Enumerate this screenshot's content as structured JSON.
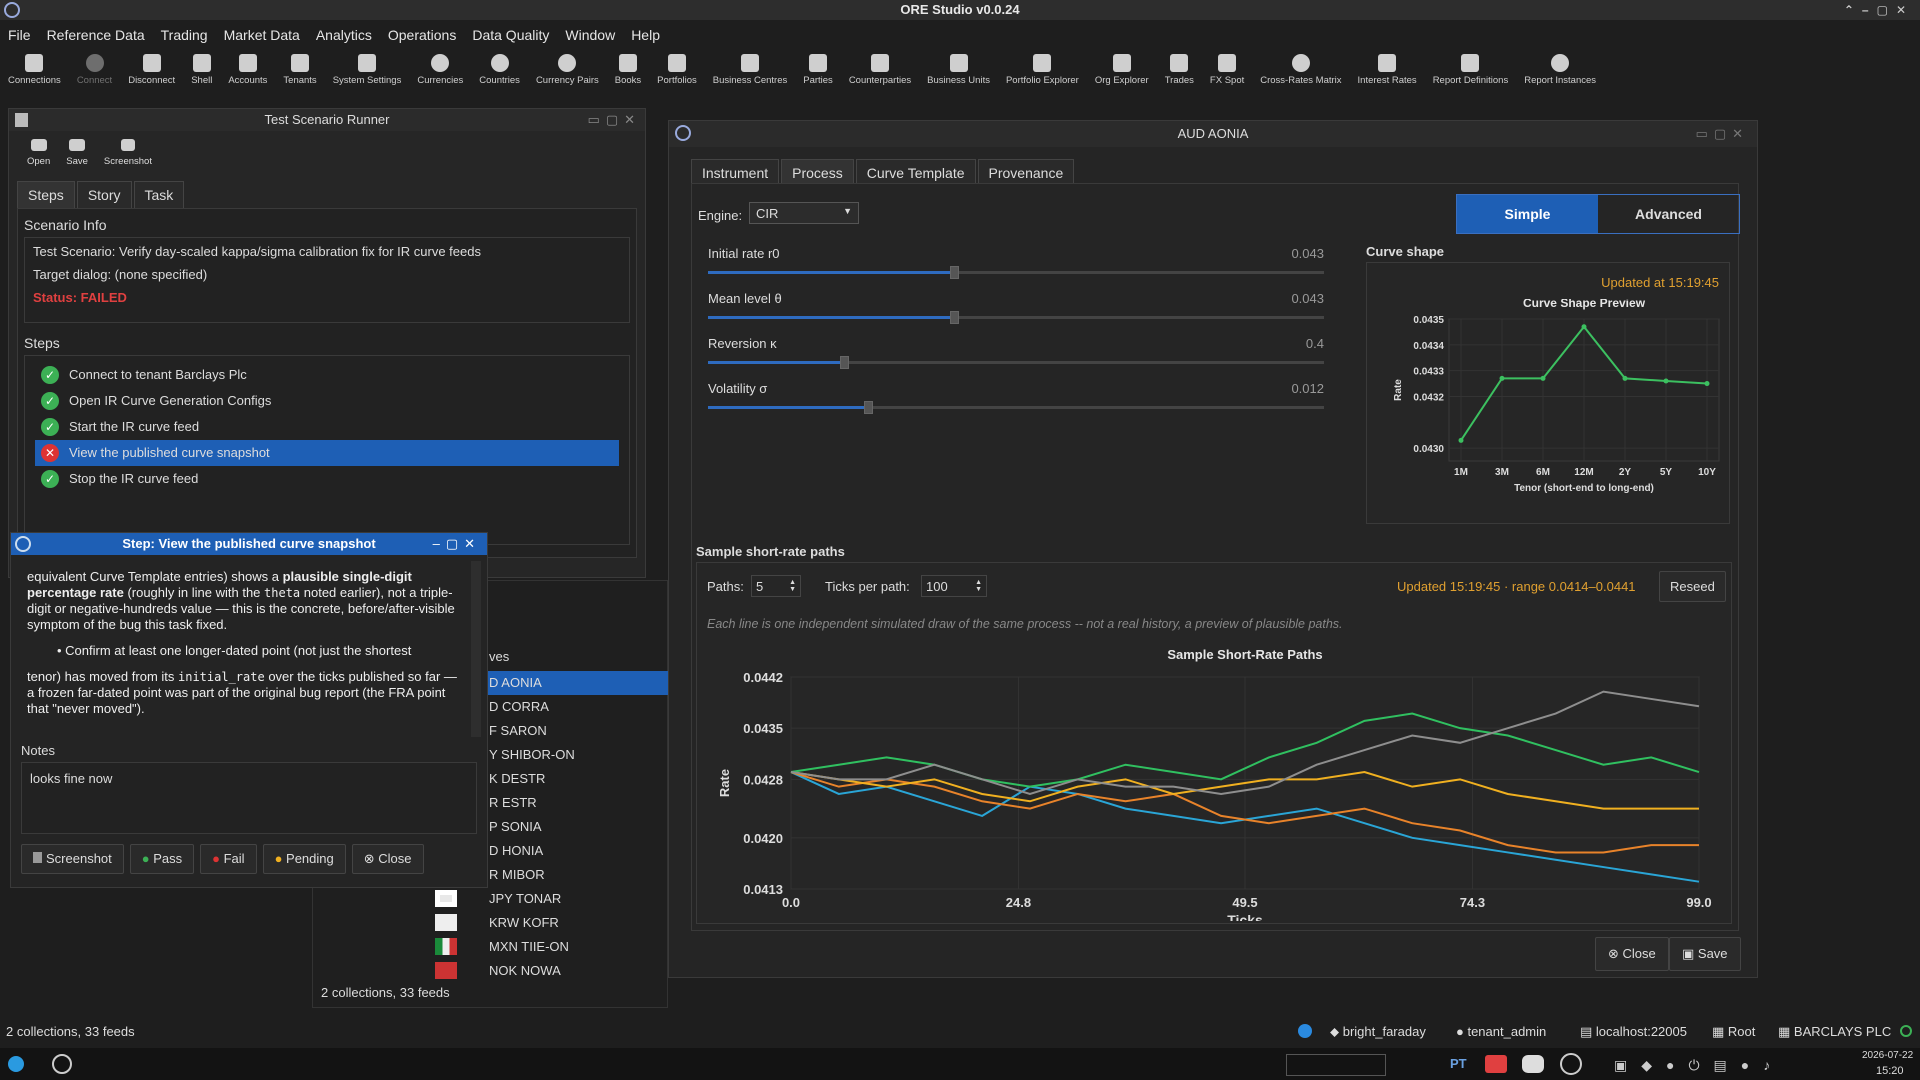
{
  "app_title": "ORE Studio v0.0.24",
  "menu": [
    "File",
    "Reference Data",
    "Trading",
    "Market Data",
    "Analytics",
    "Operations",
    "Data Quality",
    "Window",
    "Help"
  ],
  "toolbar": [
    "Connections",
    "Connect",
    "Disconnect",
    "Shell",
    "Accounts",
    "Tenants",
    "System Settings",
    "Currencies",
    "Countries",
    "Currency Pairs",
    "Books",
    "Portfolios",
    "Business Centres",
    "Parties",
    "Counterparties",
    "Business Units",
    "Portfolio Explorer",
    "Org Explorer",
    "Trades",
    "FX Spot",
    "Cross-Rates Matrix",
    "Interest Rates",
    "Report Definitions",
    "Report Instances"
  ],
  "runner": {
    "title": "Test Scenario Runner",
    "tools": [
      "Open",
      "Save",
      "Screenshot"
    ],
    "tabs": [
      "Steps",
      "Story",
      "Task"
    ],
    "info_heading": "Scenario Info",
    "scenario": "Test Scenario: Verify day-scaled kappa/sigma calibration fix for IR curve feeds",
    "target": "Target dialog: (none specified)",
    "status": "Status: FAILED",
    "steps_heading": "Steps",
    "steps": [
      "Connect to tenant Barclays Plc",
      "Open IR Curve Generation Configs",
      "Start the IR curve feed",
      "View the published curve snapshot",
      "Stop the IR curve feed"
    ]
  },
  "stepdlg": {
    "title": "Step: View the published curve snapshot",
    "para1a": "equivalent Curve Template entries) shows a ",
    "para1b": "plausible single-digit percentage rate",
    "para1c": " (roughly in line with the ",
    "para1code": "theta",
    "para1d": " noted earlier), not a triple-digit or negative-hundreds value — this is the concrete, before/after-visible symptom of the bug this task fixed.",
    "bullet": "• Confirm at least one longer-dated point (not just the shortest",
    "para2a": "tenor) has moved from its ",
    "para2code": "initial_rate",
    "para2b": " over the ticks published so far — a frozen far-dated point was part of the original bug report (the FRA point that \"never moved\").",
    "notes_label": "Notes",
    "notes": "looks fine now",
    "buttons": [
      "Screenshot",
      "Pass",
      "Fail",
      "Pending",
      "Close"
    ]
  },
  "feeds": {
    "header": "ves",
    "items": [
      "D AONIA",
      "D CORRA",
      "F SARON",
      "Y SHIBOR-ON",
      "K DESTR",
      "R ESTR",
      "P SONIA",
      "D HONIA",
      "R MIBOR",
      "JPY TONAR",
      "KRW KOFR",
      "MXN TIIE-ON",
      "NOK NOWA"
    ],
    "footer": "2 collections, 33 feeds"
  },
  "aonia": {
    "title": "AUD AONIA",
    "tabs": [
      "Instrument",
      "Process",
      "Curve Template",
      "Provenance"
    ],
    "engine_label": "Engine:",
    "engine": "CIR",
    "modes": [
      "Simple",
      "Advanced"
    ],
    "sliders": [
      {
        "label": "Initial rate r0",
        "value": "0.043",
        "pos": 0.4
      },
      {
        "label": "Mean level θ",
        "value": "0.043",
        "pos": 0.4
      },
      {
        "label": "Reversion κ",
        "value": "0.4",
        "pos": 0.22
      },
      {
        "label": "Volatility σ",
        "value": "0.012",
        "pos": 0.26
      }
    ],
    "curve_heading": "Curve shape",
    "curve_updated": "Updated at 15:19:45",
    "paths_heading": "Sample short-rate paths",
    "paths_label": "Paths:",
    "paths": "5",
    "ticks_label": "Ticks per path:",
    "ticks": "100",
    "paths_updated": "Updated 15:19:45 · range 0.0414–0.0441",
    "reseed": "Reseed",
    "caption": "Each line is one independent simulated draw of the same process -- not a real history, a preview of plausible paths.",
    "close": "Close",
    "save": "Save"
  },
  "status": {
    "left": "2 collections, 33 feeds",
    "items": [
      "bright_faraday",
      "tenant_admin",
      "localhost:22005",
      "Root",
      "BARCLAYS PLC"
    ]
  },
  "taskbar": {
    "lang": "PT",
    "date": "2026-07-22",
    "time": "15:20"
  },
  "chart_data": [
    {
      "type": "line",
      "title": "Curve Shape Preview",
      "xlabel": "Tenor (short-end to long-end)",
      "ylabel": "Rate",
      "categories": [
        "1M",
        "3M",
        "6M",
        "12M",
        "2Y",
        "5Y",
        "10Y"
      ],
      "values": [
        0.04303,
        0.04327,
        0.04327,
        0.04347,
        0.04327,
        0.04326,
        0.04325
      ],
      "ylim": [
        0.04295,
        0.0435
      ],
      "yticks": [
        "0.0435",
        "0.0434",
        "0.0433",
        "0.0432",
        "0.0430"
      ],
      "color": "#3cc060"
    },
    {
      "type": "line",
      "title": "Sample Short-Rate Paths",
      "xlabel": "Ticks",
      "ylabel": "Rate",
      "xticks": [
        "0.0",
        "24.8",
        "49.5",
        "74.3",
        "99.0"
      ],
      "yticks": [
        "0.0442",
        "0.0435",
        "0.0428",
        "0.0420",
        "0.0413"
      ],
      "xlim": [
        0,
        99
      ],
      "ylim": [
        0.0413,
        0.0442
      ],
      "series": [
        {
          "color": "#2aa5d6",
          "values": [
            0.0429,
            0.0426,
            0.0427,
            0.0425,
            0.0423,
            0.0427,
            0.0426,
            0.0424,
            0.0423,
            0.0422,
            0.0423,
            0.0424,
            0.0422,
            0.042,
            0.0419,
            0.0418,
            0.0417,
            0.0416,
            0.0415,
            0.0414
          ]
        },
        {
          "color": "#e8832a",
          "values": [
            0.0429,
            0.0427,
            0.0428,
            0.0427,
            0.0425,
            0.0424,
            0.0426,
            0.0425,
            0.0426,
            0.0423,
            0.0422,
            0.0423,
            0.0424,
            0.0422,
            0.0421,
            0.0419,
            0.0418,
            0.0418,
            0.0419,
            0.0419
          ]
        },
        {
          "color": "#f0b020",
          "values": [
            0.0429,
            0.0428,
            0.0427,
            0.0428,
            0.0426,
            0.0425,
            0.0427,
            0.0428,
            0.0426,
            0.0427,
            0.0428,
            0.0428,
            0.0429,
            0.0427,
            0.0428,
            0.0426,
            0.0425,
            0.0424,
            0.0424,
            0.0424
          ]
        },
        {
          "color": "#30c060",
          "values": [
            0.0429,
            0.043,
            0.0431,
            0.043,
            0.0428,
            0.0427,
            0.0428,
            0.043,
            0.0429,
            0.0428,
            0.0431,
            0.0433,
            0.0436,
            0.0437,
            0.0435,
            0.0434,
            0.0432,
            0.043,
            0.0431,
            0.0429
          ]
        },
        {
          "color": "#8e8e8e",
          "values": [
            0.0429,
            0.0428,
            0.0428,
            0.043,
            0.0428,
            0.0426,
            0.0428,
            0.0427,
            0.0427,
            0.0426,
            0.0427,
            0.043,
            0.0432,
            0.0434,
            0.0433,
            0.0435,
            0.0437,
            0.044,
            0.0439,
            0.0438
          ]
        }
      ]
    }
  ]
}
